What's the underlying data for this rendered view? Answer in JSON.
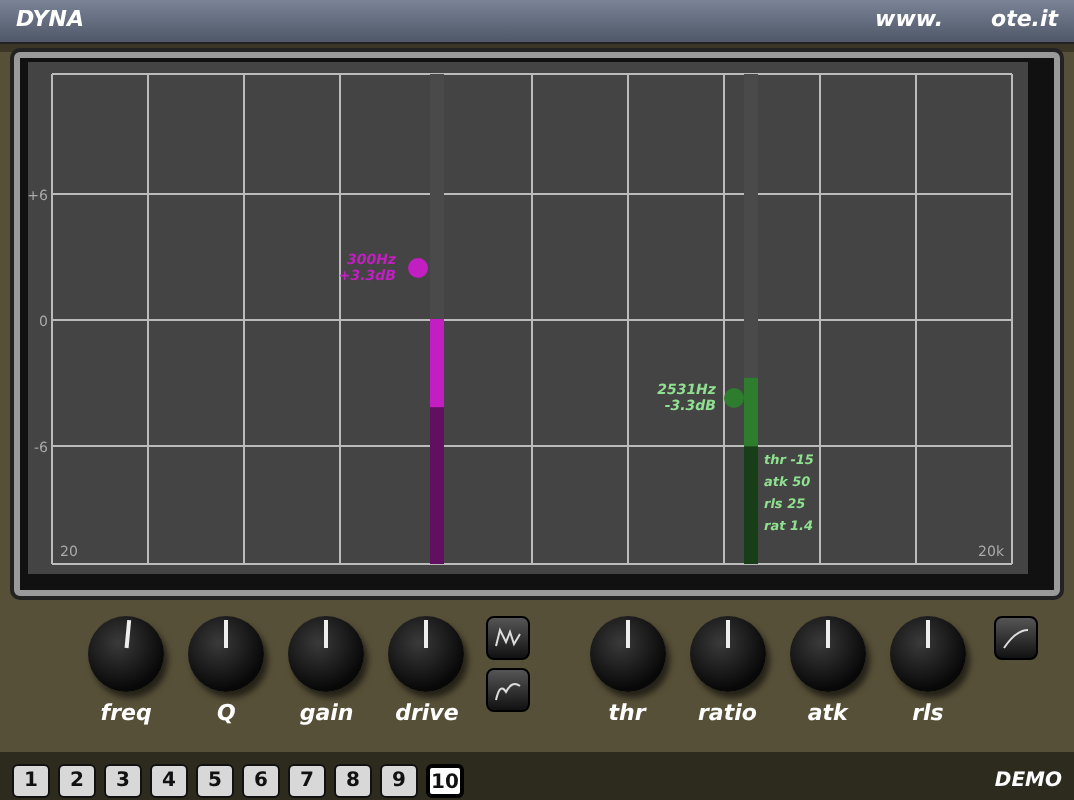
{
  "title_bar": {
    "title": "DYNA",
    "url_start": "www.",
    "url_end": "ote.it"
  },
  "display": {
    "y_ticks": [
      "+6",
      "0",
      "-6"
    ],
    "x_ticks": [
      "20",
      "20k"
    ],
    "points": [
      {
        "kind": "eq",
        "freq": "300Hz",
        "gain": "+3.3dB",
        "color": "#c21ec2"
      },
      {
        "kind": "dyn",
        "freq": "2531Hz",
        "gain": "-3.3dB",
        "color": "#2e7d2e"
      }
    ],
    "meters": [
      {
        "color": "#c21ec2",
        "level": 0.5,
        "hold": {
          "level": 0.32
        }
      },
      {
        "color": "#2e7d2e",
        "level": 0.38,
        "hold": {
          "level": 0.24
        }
      }
    ],
    "readouts": [
      "thr -15",
      "atk 50",
      "rls 25",
      "rat 1.4"
    ]
  },
  "knobs": [
    {
      "label": "freq",
      "level": 0.52
    },
    {
      "label": "Q",
      "level": 0.5
    },
    {
      "label": "gain",
      "level": 0.5
    },
    {
      "label": "drive",
      "level": 0.5
    },
    {
      "label": "thr",
      "level": 0.5
    },
    {
      "label": "ratio",
      "level": 0.5
    },
    {
      "label": "atk",
      "level": 0.5
    },
    {
      "label": "rls",
      "level": 0.5
    }
  ],
  "presets": [
    {
      "label": "1",
      "selected": false
    },
    {
      "label": "2",
      "selected": false
    },
    {
      "label": "3",
      "selected": false
    },
    {
      "label": "4",
      "selected": false
    },
    {
      "label": "5",
      "selected": false
    },
    {
      "label": "6",
      "selected": false
    },
    {
      "label": "7",
      "selected": false
    },
    {
      "label": "8",
      "selected": false
    },
    {
      "label": "9",
      "selected": false
    },
    {
      "label": "10",
      "selected": true
    }
  ],
  "footer": "DEMO"
}
